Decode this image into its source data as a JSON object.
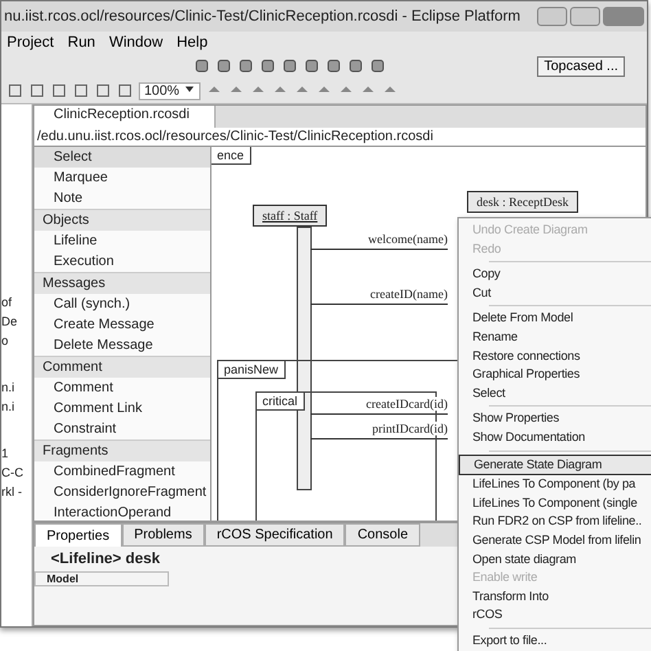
{
  "window": {
    "title": "nu.iist.rcos.ocl/resources/Clinic-Test/ClinicReception.rcosdi - Eclipse Platform"
  },
  "menu_bar": [
    "Project",
    "Run",
    "Window",
    "Help"
  ],
  "toolbar": {
    "zoom": "100%",
    "perspective": "Topcased ..."
  },
  "left_view": {
    "fragments": [
      "of",
      "De",
      "o",
      "n.i",
      "n.i",
      "1",
      "C-C",
      "rkl -"
    ]
  },
  "editor": {
    "tab": "ClinicReception.rcosdi",
    "path": "/edu.unu.iist.rcos.ocl/resources/Clinic-Test/ClinicReception.rcosdi"
  },
  "palette": {
    "items": [
      {
        "kind": "tool",
        "label": "Select",
        "selected": true
      },
      {
        "kind": "tool",
        "label": "Marquee",
        "selected": false
      },
      {
        "kind": "tool",
        "label": "Note",
        "selected": false
      },
      {
        "kind": "drawer",
        "label": "Objects"
      },
      {
        "kind": "tool",
        "label": "Lifeline",
        "selected": false
      },
      {
        "kind": "tool",
        "label": "Execution",
        "selected": false
      },
      {
        "kind": "drawer",
        "label": "Messages"
      },
      {
        "kind": "tool",
        "label": "Call (synch.)",
        "selected": false
      },
      {
        "kind": "tool",
        "label": "Create Message",
        "selected": false
      },
      {
        "kind": "tool",
        "label": "Delete Message",
        "selected": false
      },
      {
        "kind": "drawer",
        "label": "Comment"
      },
      {
        "kind": "tool",
        "label": "Comment",
        "selected": false
      },
      {
        "kind": "tool",
        "label": "Comment Link",
        "selected": false
      },
      {
        "kind": "tool",
        "label": "Constraint",
        "selected": false
      },
      {
        "kind": "drawer",
        "label": "Fragments"
      },
      {
        "kind": "tool",
        "label": "CombinedFragment",
        "selected": false
      },
      {
        "kind": "tool",
        "label": "ConsiderIgnoreFragment",
        "selected": false
      },
      {
        "kind": "tool",
        "label": "InteractionOperand",
        "selected": false
      }
    ]
  },
  "diagram": {
    "frame_label": "ence",
    "lifelines": [
      "staff : Staff",
      "desk : ReceptDesk"
    ],
    "messages": [
      "welcome(name)",
      "createID(name)",
      "createIDcard(id)",
      "printIDcard(id)"
    ],
    "fragments": [
      "panisNew",
      "critical"
    ]
  },
  "bottom_tabs": [
    {
      "label": "Properties",
      "selected": true
    },
    {
      "label": "Problems",
      "selected": false
    },
    {
      "label": "rCOS Specification",
      "selected": false
    },
    {
      "label": "Console",
      "selected": false
    }
  ],
  "properties": {
    "title": "<Lifeline> desk",
    "section": "Model"
  },
  "context_menu": [
    {
      "kind": "item",
      "label": "Undo Create Diagram",
      "disabled": true,
      "selected": false
    },
    {
      "kind": "item",
      "label": "Redo",
      "disabled": true,
      "selected": false
    },
    {
      "kind": "separator"
    },
    {
      "kind": "item",
      "label": "Copy",
      "disabled": false,
      "selected": false
    },
    {
      "kind": "item",
      "label": "Cut",
      "disabled": false,
      "selected": false
    },
    {
      "kind": "separator"
    },
    {
      "kind": "item",
      "label": "Delete From Model",
      "disabled": false,
      "selected": false
    },
    {
      "kind": "item",
      "label": "Rename",
      "disabled": false,
      "selected": false
    },
    {
      "kind": "item",
      "label": "Restore connections",
      "disabled": false,
      "selected": false
    },
    {
      "kind": "item",
      "label": "Graphical Properties",
      "disabled": false,
      "selected": false
    },
    {
      "kind": "item",
      "label": "Select",
      "disabled": false,
      "selected": false
    },
    {
      "kind": "separator"
    },
    {
      "kind": "item",
      "label": "Show Properties",
      "disabled": false,
      "selected": false
    },
    {
      "kind": "item",
      "label": "Show Documentation",
      "disabled": false,
      "selected": false
    },
    {
      "kind": "separator"
    },
    {
      "kind": "item",
      "label": "Generate State Diagram",
      "disabled": false,
      "selected": true
    },
    {
      "kind": "item",
      "label": "LifeLines To Component (by pa",
      "disabled": false,
      "selected": false
    },
    {
      "kind": "item",
      "label": "LifeLines To Component (single",
      "disabled": false,
      "selected": false
    },
    {
      "kind": "item",
      "label": "Run FDR2 on CSP from lifeline..",
      "disabled": false,
      "selected": false
    },
    {
      "kind": "item",
      "label": "Generate CSP Model from lifelin",
      "disabled": false,
      "selected": false
    },
    {
      "kind": "item",
      "label": "Open state diagram",
      "disabled": false,
      "selected": false
    },
    {
      "kind": "item",
      "label": "Enable write",
      "disabled": true,
      "selected": false
    },
    {
      "kind": "item",
      "label": "Transform Into",
      "disabled": false,
      "selected": false
    },
    {
      "kind": "item",
      "label": "rCOS",
      "disabled": false,
      "selected": false
    },
    {
      "kind": "separator"
    },
    {
      "kind": "item",
      "label": "Export to file...",
      "disabled": false,
      "selected": false
    }
  ]
}
